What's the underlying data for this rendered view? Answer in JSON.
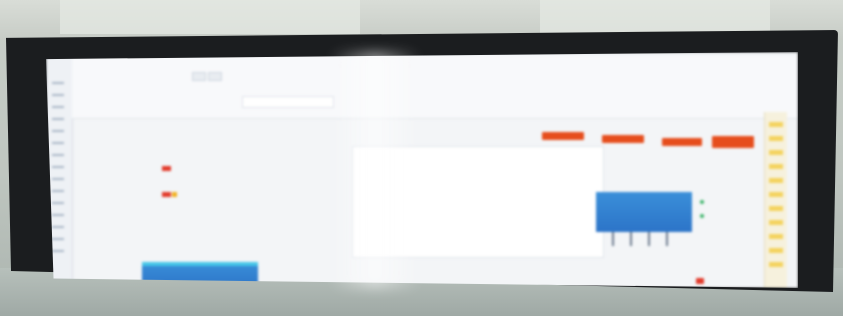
{
  "scene": {
    "description_colors": {
      "accent_orange": "#e64d1c",
      "panel_blue": "#2c74c8",
      "status_red": "#e23a2a",
      "status_yellow": "#f2b01e",
      "status_green": "#3cb56a"
    },
    "icons": [
      "monitor-icon"
    ]
  },
  "screen": {
    "texts": {
      "t1": "",
      "t2": "",
      "t3": "",
      "t4": "",
      "t5": "",
      "t6": "",
      "t7": "",
      "t8": ""
    }
  }
}
